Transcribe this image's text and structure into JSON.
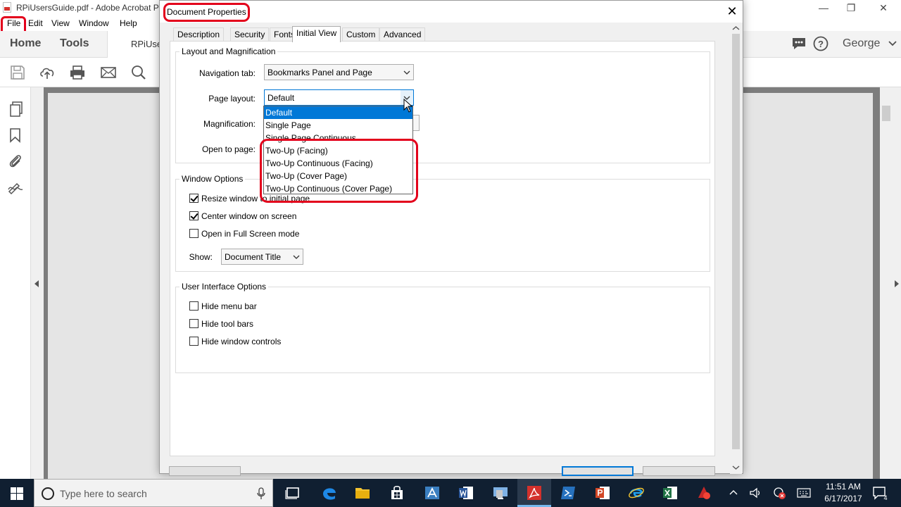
{
  "app": {
    "title": "RPiUsersGuide.pdf - Adobe Acrobat Pr",
    "controls": {
      "minimize": "—",
      "restore": "❐",
      "close": "✕"
    },
    "menu": [
      "File",
      "Edit",
      "View",
      "Window",
      "Help"
    ],
    "nav": {
      "home": "Home",
      "tools": "Tools",
      "doc_tab": "RPiUse",
      "user": "George"
    }
  },
  "dialog": {
    "title": "Document Properties",
    "close": "✕",
    "tabs": [
      "Description",
      "Security",
      "Fonts",
      "Initial View",
      "Custom",
      "Advanced"
    ],
    "active_tab": "Initial View",
    "layout_group": {
      "title": "Layout and Magnification",
      "navigation_tab": {
        "label": "Navigation tab:",
        "value": "Bookmarks Panel and Page"
      },
      "page_layout": {
        "label": "Page layout:",
        "value": "Default",
        "options": [
          "Default",
          "Single Page",
          "Single Page Continuous",
          "Two-Up (Facing)",
          "Two-Up Continuous (Facing)",
          "Two-Up (Cover Page)",
          "Two-Up Continuous (Cover Page)"
        ],
        "selected": "Default"
      },
      "magnification": {
        "label": "Magnification:"
      },
      "open_to_page": {
        "label": "Open to page:"
      }
    },
    "window_group": {
      "title": "Window Options",
      "resize": {
        "label": "Resize window to initial page",
        "checked": true
      },
      "center": {
        "label": "Center window on screen",
        "checked": true
      },
      "fullscreen": {
        "label": "Open in Full Screen mode",
        "checked": false
      },
      "show": {
        "label": "Show:",
        "value": "Document Title"
      }
    },
    "ui_group": {
      "title": "User Interface Options",
      "hide_menu": {
        "label": "Hide menu bar",
        "checked": false
      },
      "hide_tools": {
        "label": "Hide tool bars",
        "checked": false
      },
      "hide_controls": {
        "label": "Hide window controls",
        "checked": false
      }
    }
  },
  "taskbar": {
    "search_placeholder": "Type here to search",
    "time": "11:51 AM",
    "date": "6/17/2017",
    "notification_count": "4"
  },
  "colors": {
    "accent": "#0078d7",
    "annotation": "#e3001b",
    "taskbar": "#101f31"
  }
}
